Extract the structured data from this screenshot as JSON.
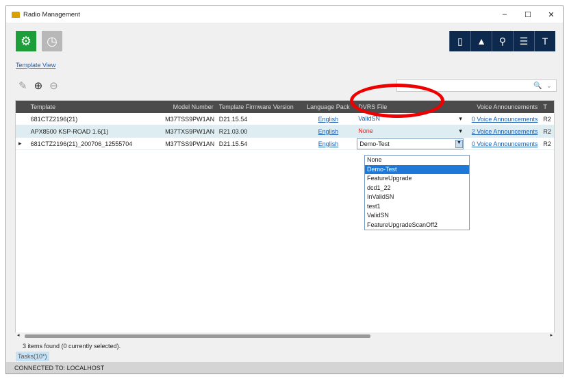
{
  "window": {
    "title": "Radio Management",
    "controls": [
      "–",
      "☐",
      "✕"
    ]
  },
  "toolbar": {
    "right_icons": [
      "radio-icon",
      "tower-icon",
      "key-icon",
      "list-icon",
      "hammer-icon"
    ]
  },
  "template_view": "Template View",
  "grid": {
    "headers": [
      "Template",
      "Model Number",
      "Template Firmware Version",
      "Language Pack",
      "DVRS File",
      "Voice Announcements",
      "T"
    ],
    "rows": [
      {
        "template": "681CTZ2196(21)",
        "model": "M37TSS9PW1AN",
        "fw": "D21.15.54",
        "lang": "English",
        "dvrs": "ValidSN",
        "voice": "0 Voice Announcements",
        "t": "R2"
      },
      {
        "template": "APX8500 KSP-ROAD 1.6(1)",
        "model": "M37TXS9PW1AN",
        "fw": "R21.03.00",
        "lang": "English",
        "dvrs": "None",
        "voice": "2 Voice Announcements",
        "t": "R2"
      },
      {
        "template": "681CTZ2196(21)_200706_12555704",
        "model": "M37TSS9PW1AN",
        "fw": "D21.15.54",
        "lang": "English",
        "dvrs": "Demo-Test",
        "voice": "0 Voice Announcements",
        "t": "R2"
      }
    ]
  },
  "dvrs_options": [
    "None",
    "Demo-Test",
    "FeatureUpgrade",
    "dcd1_22",
    "InValidSN",
    "test1",
    "ValidSN",
    "FeatureUpgradeScanOff2"
  ],
  "status": "3 items found (0 currently selected).",
  "tasks": "Tasks(10*)",
  "footer": "CONNECTED TO: LOCALHOST",
  "colors": {
    "accent": "#1e9e3a",
    "header": "#4b4b4b",
    "highlight": "#e00000"
  }
}
